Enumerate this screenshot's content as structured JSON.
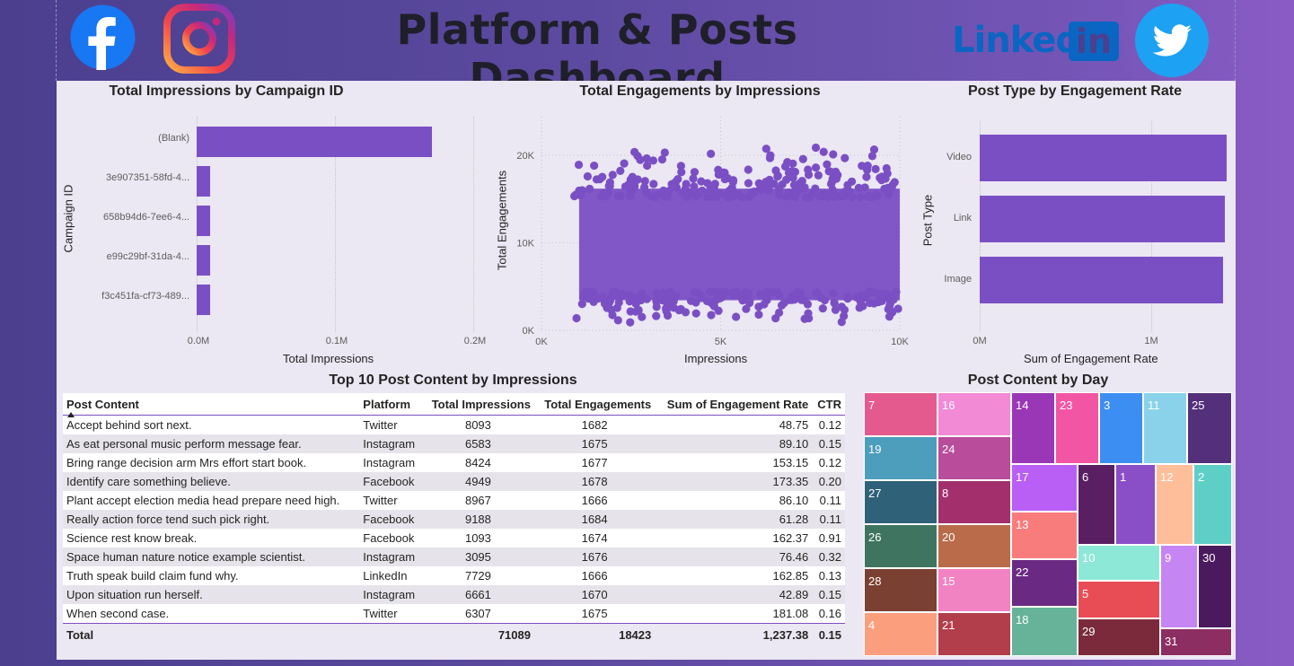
{
  "header": {
    "title": "Platform & Posts Dashboard",
    "logos": [
      {
        "name": "facebook",
        "color": "#1877f2"
      },
      {
        "name": "instagram",
        "color": "#e1306c"
      },
      {
        "name": "linkedin",
        "text": "Linked",
        "badge": "in",
        "color": "#0a66c2"
      },
      {
        "name": "twitter",
        "color": "#1da1f2"
      }
    ]
  },
  "impressions_by_campaign": {
    "chart_data": {
      "type": "bar",
      "title": "Total Impressions by Campaign ID",
      "xlabel": "Total Impressions",
      "ylabel": "Campaign ID",
      "categories": [
        "(Blank)",
        "3e907351-58fd-4...",
        "658b94d6-7ee6-4...",
        "e99c29bf-31da-4...",
        "f3c451fa-cf73-489..."
      ],
      "values": [
        170000,
        10000,
        10000,
        10000,
        10000
      ],
      "xlim": [
        0,
        200000
      ],
      "xticks": [
        "0.0M",
        "0.1M",
        "0.2M"
      ],
      "color": "#7b4fc4"
    }
  },
  "engagements_by_impressions": {
    "chart_data": {
      "type": "scatter",
      "title": "Total Engagements by Impressions",
      "xlabel": "Impressions",
      "ylabel": "Total Engagements",
      "xlim": [
        0,
        10000
      ],
      "ylim": [
        0,
        23000
      ],
      "xticks": [
        "0K",
        "5K",
        "10K"
      ],
      "yticks": [
        "0K",
        "10K",
        "20K"
      ],
      "x_range": [
        900,
        10000
      ],
      "y_range": [
        500,
        22000
      ],
      "color": "#7b4fc4"
    }
  },
  "post_type_by_rate": {
    "chart_data": {
      "type": "bar",
      "title": "Post Type by Engagement Rate",
      "xlabel": "Sum of Engagement Rate",
      "ylabel": "Post Type",
      "categories": [
        "Video",
        "Link",
        "Image"
      ],
      "values": [
        1440000,
        1430000,
        1420000
      ],
      "xlim": [
        0,
        1450000
      ],
      "xticks": [
        "0M",
        "1M"
      ],
      "color": "#7b4fc4"
    }
  },
  "top10": {
    "title": "Top 10 Post Content by Impressions",
    "columns": [
      "Post Content",
      "Platform",
      "Total Impressions",
      "Total Engagements",
      "Sum of Engagement Rate",
      "CTR"
    ],
    "rows": [
      [
        "Accept behind sort next.",
        "Twitter",
        "8093",
        "1682",
        "48.75",
        "0.12"
      ],
      [
        "As eat personal music perform message fear.",
        "Instagram",
        "6583",
        "1675",
        "89.10",
        "0.15"
      ],
      [
        "Bring range decision arm Mrs effort start book.",
        "Instagram",
        "8424",
        "1677",
        "153.15",
        "0.12"
      ],
      [
        "Identify care something believe.",
        "Facebook",
        "4949",
        "1678",
        "173.35",
        "0.20"
      ],
      [
        "Plant accept election media head prepare need high.",
        "Twitter",
        "8967",
        "1666",
        "86.10",
        "0.11"
      ],
      [
        "Really action force tend such pick right.",
        "Facebook",
        "9188",
        "1684",
        "61.28",
        "0.11"
      ],
      [
        "Science rest know break.",
        "Facebook",
        "1093",
        "1674",
        "162.37",
        "0.91"
      ],
      [
        "Space human nature notice example scientist.",
        "Instagram",
        "3095",
        "1676",
        "76.46",
        "0.32"
      ],
      [
        "Truth speak build claim fund why.",
        "LinkedIn",
        "7729",
        "1666",
        "162.85",
        "0.13"
      ],
      [
        "Upon situation run herself.",
        "Instagram",
        "6661",
        "1670",
        "42.89",
        "0.15"
      ],
      [
        "When second case.",
        "Twitter",
        "6307",
        "1675",
        "181.08",
        "0.16"
      ]
    ],
    "total": {
      "label": "Total",
      "impressions": "71089",
      "engagements": "18423",
      "rate": "1,237.38",
      "ctr": "0.15"
    }
  },
  "treemap": {
    "title": "Post Content by Day",
    "cells": [
      {
        "label": "7",
        "color": "#e55a8e"
      },
      {
        "label": "16",
        "color": "#f28ad6"
      },
      {
        "label": "19",
        "color": "#4d9ebc"
      },
      {
        "label": "24",
        "color": "#b94c9b"
      },
      {
        "label": "27",
        "color": "#2f6279"
      },
      {
        "label": "8",
        "color": "#a3306c"
      },
      {
        "label": "26",
        "color": "#3f7560"
      },
      {
        "label": "20",
        "color": "#b96b4a"
      },
      {
        "label": "28",
        "color": "#7a4031"
      },
      {
        "label": "15",
        "color": "#f283c3"
      },
      {
        "label": "4",
        "color": "#fb9e7e"
      },
      {
        "label": "21",
        "color": "#b23e4b"
      },
      {
        "label": "14",
        "color": "#9a37b7"
      },
      {
        "label": "23",
        "color": "#f255a4"
      },
      {
        "label": "3",
        "color": "#3d8ef2"
      },
      {
        "label": "11",
        "color": "#8ad2ea"
      },
      {
        "label": "25",
        "color": "#54307a"
      },
      {
        "label": "17",
        "color": "#b95ff5"
      },
      {
        "label": "6",
        "color": "#5a1e63"
      },
      {
        "label": "1",
        "color": "#8a4ec7"
      },
      {
        "label": "12",
        "color": "#ffbe9a"
      },
      {
        "label": "2",
        "color": "#5ecfc7"
      },
      {
        "label": "13",
        "color": "#f97c7c"
      },
      {
        "label": "10",
        "color": "#8ee8d8"
      },
      {
        "label": "9",
        "color": "#c585f2"
      },
      {
        "label": "30",
        "color": "#4b1a5e"
      },
      {
        "label": "22",
        "color": "#6a2a83"
      },
      {
        "label": "5",
        "color": "#e84c55"
      },
      {
        "label": "18",
        "color": "#66b39a"
      },
      {
        "label": "29",
        "color": "#7a2a3a"
      },
      {
        "label": "31",
        "color": "#8c2e62"
      }
    ]
  }
}
